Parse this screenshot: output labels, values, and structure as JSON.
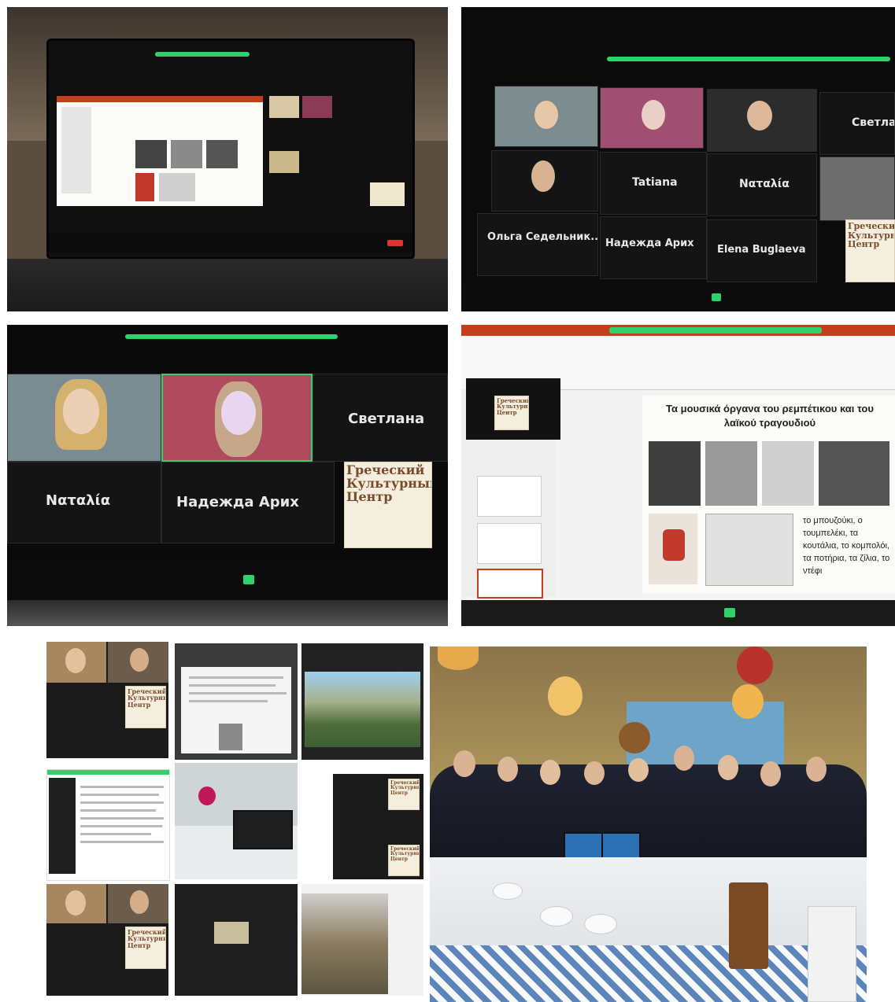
{
  "photos": {
    "top_right": {
      "names": [
        "Светлана",
        "Tatiana",
        "Nαταλία",
        "Ольга Седельник...",
        "Надежда Арих",
        "Elena Buglaeva"
      ],
      "logo": "Греческий Культурный Центр"
    },
    "middle_left": {
      "names": [
        "Светлана",
        "Nαταλία",
        "Надежда Арих"
      ],
      "logo": "Греческий Культурный Центр"
    },
    "middle_right": {
      "slide_title": "Τα μουσικά όργανα του ρεμπέτικου και του λαϊκού τραγουδιού",
      "slide_text": "το μπουζούκι, ο τουμπελέκι, τα κουτάλια, το κομπολόι, τα ποτήρια, τα ζίλια, το ντέφι",
      "logo": "Греческий Культурный Центр"
    },
    "collage": {
      "logo": "Греческий Культурный Центр"
    }
  },
  "colors": {
    "zoom_green": "#2fd16a",
    "zoom_dark": "#141414",
    "ppt_orange": "#c43e1c",
    "logo_brown": "#7a4a2a"
  }
}
